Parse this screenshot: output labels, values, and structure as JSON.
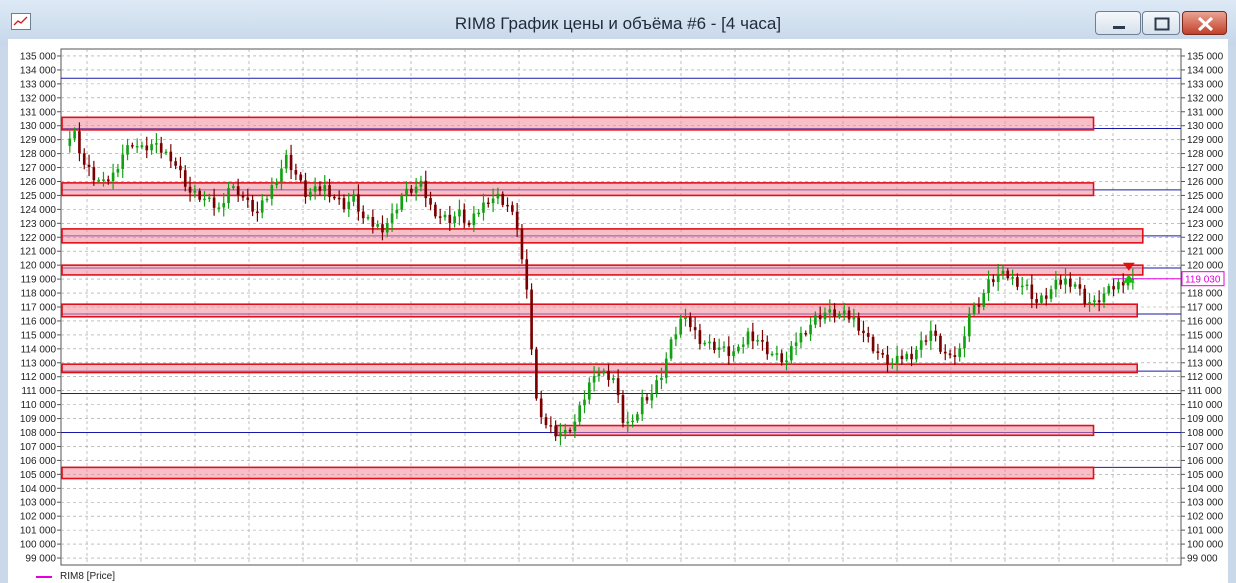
{
  "window": {
    "title": "RIM8 График цены и объёма #6 - [4 часа]",
    "icon": "chart-window-icon",
    "buttons": {
      "minimize": "minimize-icon",
      "maximize": "maximize-icon",
      "close": "close-icon"
    }
  },
  "chart_data": {
    "type": "candlestick",
    "title": "",
    "y_ticks": [
      "135 000",
      "134 000",
      "133 000",
      "132 000",
      "131 000",
      "130 000",
      "129 000",
      "128 000",
      "127 000",
      "126 000",
      "125 000",
      "124 000",
      "123 000",
      "122 000",
      "121 000",
      "120 000",
      "119 000",
      "118 000",
      "117 000",
      "116 000",
      "115 000",
      "114 000",
      "113 000",
      "112 000",
      "111 000",
      "110 000",
      "109 000",
      "108 000",
      "107 000",
      "106 000",
      "105 000",
      "104 000",
      "103 000",
      "102 000",
      "101 000",
      "100 000",
      "99 000"
    ],
    "ylim": [
      98500,
      135500
    ],
    "grid": true,
    "last_price": 119030,
    "last_price_label": "119 030",
    "price_line_color": "#e000e0",
    "up_color": "#13a113",
    "down_color": "#7a0000",
    "zone_color": "#f28b9a",
    "line_color": "#1a1aa8",
    "support_resistance_lines": [
      133400,
      129800,
      125400,
      122100,
      119800,
      116500,
      112400,
      110800,
      108000,
      105500
    ],
    "zones": [
      {
        "low": 129700,
        "high": 130600,
        "x_start": 0.0,
        "x_end": 0.921
      },
      {
        "low": 125000,
        "high": 125900,
        "x_start": 0.0,
        "x_end": 0.921
      },
      {
        "low": 121600,
        "high": 122600,
        "x_start": 0.0,
        "x_end": 0.965
      },
      {
        "low": 119300,
        "high": 120000,
        "x_start": 0.0,
        "x_end": 0.965
      },
      {
        "low": 116300,
        "high": 117200,
        "x_start": 0.0,
        "x_end": 0.96
      },
      {
        "low": 112300,
        "high": 112900,
        "x_start": 0.0,
        "x_end": 0.96
      },
      {
        "low": 107800,
        "high": 108500,
        "x_start": 0.442,
        "x_end": 0.921
      },
      {
        "low": 104700,
        "high": 105500,
        "x_start": 0.0,
        "x_end": 0.921
      }
    ],
    "key_prices": [
      [
        0,
        128900
      ],
      [
        2,
        129400
      ],
      [
        4,
        127200
      ],
      [
        6,
        126300
      ],
      [
        8,
        125800
      ],
      [
        10,
        126500
      ],
      [
        12,
        128000
      ],
      [
        14,
        128800
      ],
      [
        16,
        128300
      ],
      [
        18,
        128600
      ],
      [
        20,
        128200
      ],
      [
        22,
        127800
      ],
      [
        24,
        126600
      ],
      [
        26,
        125200
      ],
      [
        28,
        124900
      ],
      [
        30,
        124500
      ],
      [
        32,
        124000
      ],
      [
        34,
        125600
      ],
      [
        36,
        125300
      ],
      [
        38,
        124400
      ],
      [
        40,
        123700
      ],
      [
        42,
        124900
      ],
      [
        44,
        126300
      ],
      [
        46,
        127700
      ],
      [
        48,
        126500
      ],
      [
        50,
        125100
      ],
      [
        52,
        125300
      ],
      [
        54,
        125600
      ],
      [
        56,
        124900
      ],
      [
        58,
        124300
      ],
      [
        60,
        124800
      ],
      [
        62,
        123300
      ],
      [
        64,
        122900
      ],
      [
        66,
        122700
      ],
      [
        68,
        123500
      ],
      [
        70,
        125000
      ],
      [
        72,
        125400
      ],
      [
        74,
        125700
      ],
      [
        76,
        124200
      ],
      [
        78,
        123500
      ],
      [
        80,
        123300
      ],
      [
        82,
        123700
      ],
      [
        84,
        122800
      ],
      [
        86,
        123900
      ],
      [
        88,
        124800
      ],
      [
        90,
        124900
      ],
      [
        92,
        124300
      ],
      [
        94,
        122800
      ],
      [
        96,
        117900
      ],
      [
        98,
        110300
      ],
      [
        100,
        108600
      ],
      [
        102,
        108000
      ],
      [
        104,
        107900
      ],
      [
        106,
        108700
      ],
      [
        108,
        110500
      ],
      [
        110,
        112400
      ],
      [
        112,
        112200
      ],
      [
        114,
        111900
      ],
      [
        116,
        108900
      ],
      [
        118,
        108500
      ],
      [
        120,
        110400
      ],
      [
        122,
        110900
      ],
      [
        124,
        112200
      ],
      [
        126,
        114400
      ],
      [
        128,
        116100
      ],
      [
        130,
        115700
      ],
      [
        132,
        114700
      ],
      [
        134,
        114300
      ],
      [
        136,
        114100
      ],
      [
        138,
        113700
      ],
      [
        140,
        113800
      ],
      [
        142,
        115100
      ],
      [
        144,
        114700
      ],
      [
        146,
        113900
      ],
      [
        148,
        113400
      ],
      [
        150,
        113100
      ],
      [
        152,
        114600
      ],
      [
        154,
        115400
      ],
      [
        156,
        116200
      ],
      [
        158,
        116600
      ],
      [
        160,
        116500
      ],
      [
        162,
        116400
      ],
      [
        164,
        116100
      ],
      [
        166,
        115200
      ],
      [
        168,
        114100
      ],
      [
        170,
        113300
      ],
      [
        172,
        112900
      ],
      [
        174,
        113400
      ],
      [
        176,
        113600
      ],
      [
        178,
        114400
      ],
      [
        180,
        115300
      ],
      [
        182,
        114000
      ],
      [
        184,
        113200
      ],
      [
        186,
        113900
      ],
      [
        188,
        116600
      ],
      [
        190,
        117300
      ],
      [
        192,
        118700
      ],
      [
        194,
        119300
      ],
      [
        196,
        119200
      ],
      [
        198,
        118800
      ],
      [
        200,
        118400
      ],
      [
        202,
        117300
      ],
      [
        204,
        117800
      ],
      [
        206,
        118600
      ],
      [
        208,
        118900
      ],
      [
        210,
        118700
      ],
      [
        212,
        117500
      ],
      [
        214,
        117200
      ],
      [
        216,
        117900
      ],
      [
        218,
        118400
      ],
      [
        220,
        118900
      ],
      [
        222,
        119030
      ]
    ]
  },
  "legend": {
    "label": "RIM8 [Price]",
    "color": "#e000e0"
  }
}
